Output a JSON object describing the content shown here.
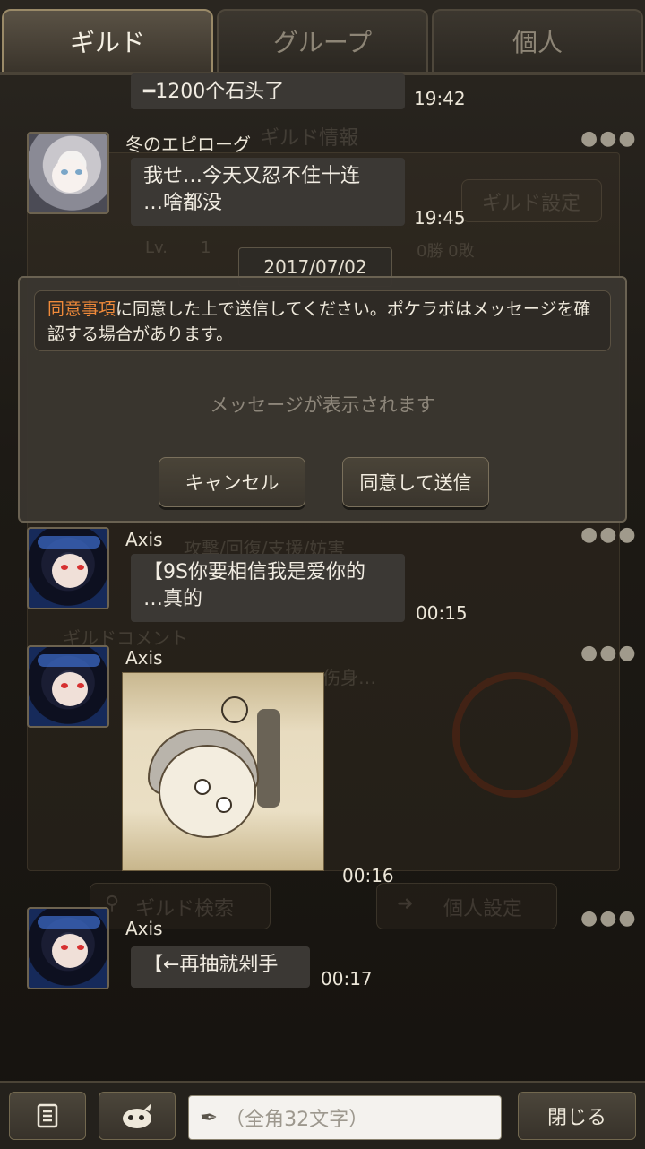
{
  "tabs": [
    {
      "label": "ギルド",
      "active": true
    },
    {
      "label": "グループ",
      "active": false
    },
    {
      "label": "個人",
      "active": false
    }
  ],
  "background": {
    "guild_info": "ギルド情報",
    "guild_settings": "ギルド設定",
    "lv_label": "Lv.",
    "lv_value": "1",
    "record": "0勝 0敗",
    "roles": "攻撃/回復/支援/妨害",
    "guild_comment": "ギルドコメント",
    "comment_text": "伤身…",
    "guild_search": "ギルド検索",
    "personal_settings": "個人設定"
  },
  "messages": [
    {
      "name": "",
      "text": "━1200个石头了",
      "time": "19:42"
    },
    {
      "name": "冬のエピローグ",
      "text": "我せ…今天又忍不住十连\n…啥都没",
      "time": "19:45"
    },
    {
      "name": "Axis",
      "text": "【9S你要相信我是爱你的\n…真的",
      "time": "00:15"
    },
    {
      "name": "Axis",
      "text": "",
      "time": "00:16",
      "sticker": true
    },
    {
      "name": "Axis",
      "text": "【←再抽就剁手",
      "time": "00:17"
    }
  ],
  "date_badge": "2017/07/02",
  "dialog": {
    "notice_accent": "同意事項",
    "notice_rest": "に同意した上で送信してください。ポケラボはメッセージを確認する場合があります。",
    "placeholder": "メッセージが表示されます",
    "cancel_label": "キャンセル",
    "agree_label": "同意して送信"
  },
  "bottom": {
    "input_placeholder": "（全角32文字）",
    "close_label": "閉じる"
  },
  "more_dots": "●●●",
  "colors": {
    "accent": "#f08a3a",
    "bubble": "#3b3834"
  }
}
